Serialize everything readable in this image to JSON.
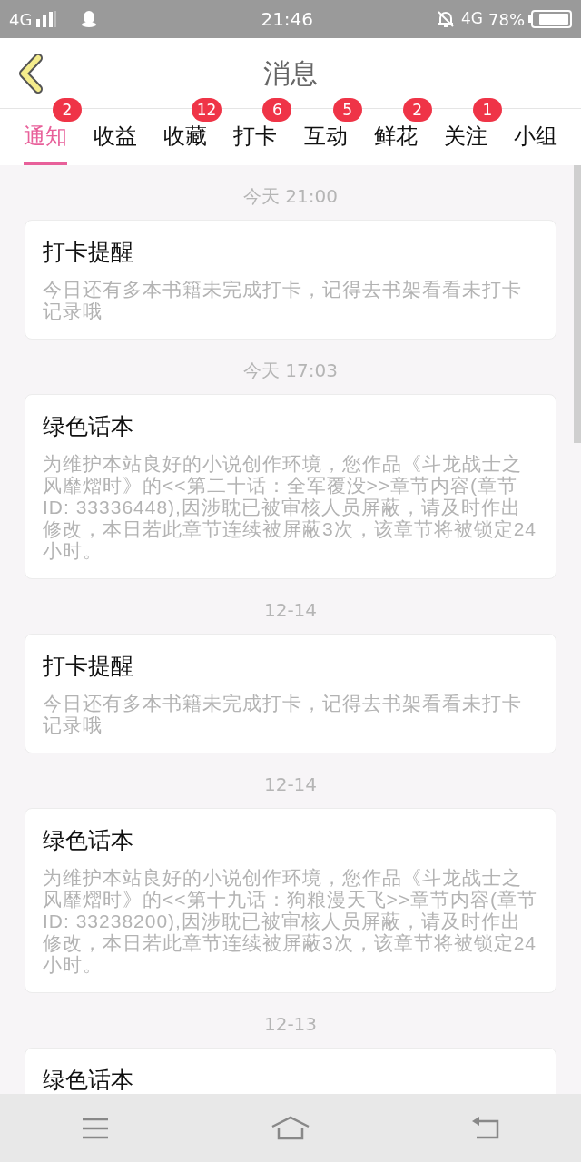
{
  "status_bar": {
    "network": "4G",
    "time": "21:46",
    "data_network": "4G",
    "battery": "78%"
  },
  "header": {
    "title": "消息"
  },
  "tabs": [
    {
      "label": "通知",
      "badge": "2",
      "selected": true
    },
    {
      "label": "收益",
      "selected": false
    },
    {
      "label": "收藏",
      "badge": "12",
      "selected": false
    },
    {
      "label": "打卡",
      "badge": "6",
      "selected": false
    },
    {
      "label": "互动",
      "badge": "5",
      "selected": false
    },
    {
      "label": "鲜花",
      "badge": "2",
      "selected": false
    },
    {
      "label": "关注",
      "badge": "1",
      "selected": false
    },
    {
      "label": "小组",
      "selected": false
    }
  ],
  "messages": [
    {
      "time": "今天 21:00",
      "title": "打卡提醒",
      "body": "今日还有多本书籍未完成打卡，记得去书架看看未打卡记录哦"
    },
    {
      "time": "今天 17:03",
      "title": "绿色话本",
      "body": "为维护本站良好的小说创作环境，您作品《斗龙战士之风靡熠时》的<<第二十话：全军覆没>>章节内容(章节ID: 33336448),因涉耽已被审核人员屏蔽，请及时作出修改，本日若此章节连续被屏蔽3次，该章节将被锁定24小时。"
    },
    {
      "time": "12-14",
      "title": "打卡提醒",
      "body": "今日还有多本书籍未完成打卡，记得去书架看看未打卡记录哦"
    },
    {
      "time": "12-14",
      "title": "绿色话本",
      "body": "为维护本站良好的小说创作环境，您作品《斗龙战士之风靡熠时》的<<第十九话：狗粮漫天飞>>章节内容(章节ID: 33238200),因涉耽已被审核人员屏蔽，请及时作出修改，本日若此章节连续被屏蔽3次，该章节将被锁定24小时。"
    },
    {
      "time": "12-13",
      "title": "绿色话本"
    }
  ]
}
